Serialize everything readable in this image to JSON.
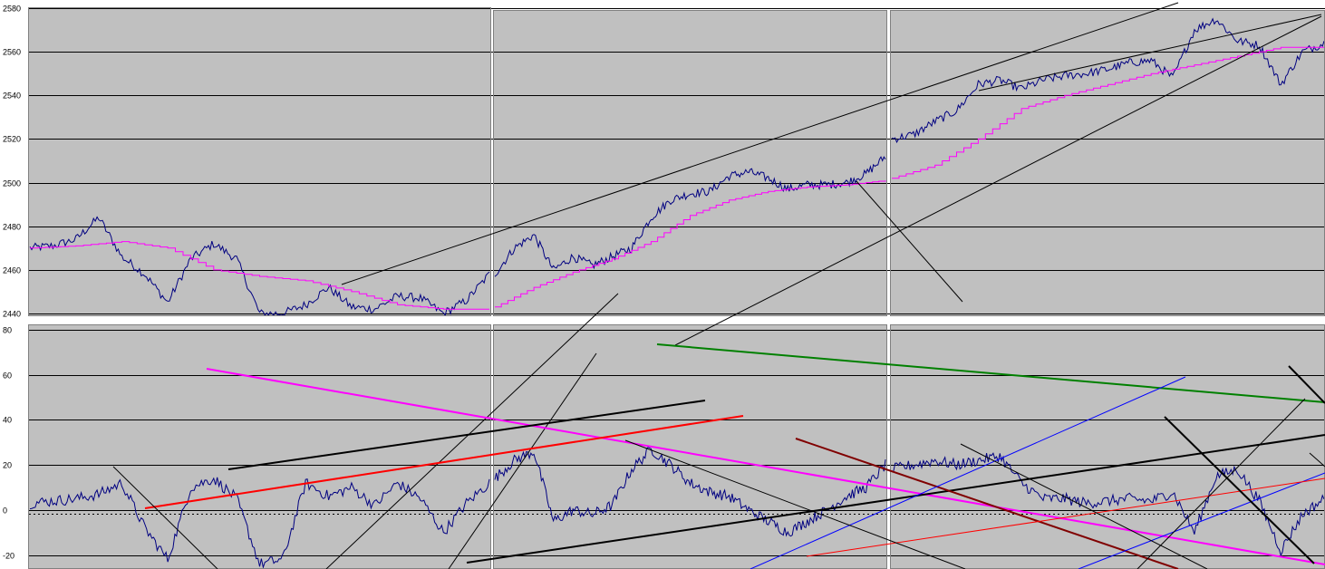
{
  "colors": {
    "plot_bg": "#c0c0c0",
    "grid": "#000000",
    "price": "#000080",
    "average": "#ff00ff",
    "trend_red": "#ff0000",
    "trend_green": "#008000",
    "trend_blue": "#0000ff",
    "trend_darkred": "#800000",
    "trend_black": "#000000"
  },
  "chart_data": [
    {
      "type": "line",
      "title": "",
      "xlabel": "",
      "ylabel": "",
      "ylim": [
        2440,
        2580
      ],
      "yticks": [
        "2580",
        "2560",
        "2540",
        "2520",
        "2500",
        "2480",
        "2460",
        "2440"
      ],
      "grid": true,
      "panels": 3,
      "series": [
        {
          "role": "price",
          "x": [
            0,
            0.05,
            0.1,
            0.15,
            0.2,
            0.25,
            0.3,
            0.35,
            0.4,
            0.45,
            0.5,
            0.55,
            0.6,
            0.65,
            0.7,
            0.75,
            0.8,
            0.85,
            0.9,
            0.95,
            1.0
          ],
          "values": [
            2470,
            2471,
            2474,
            2484,
            2466,
            2458,
            2445,
            2465,
            2472,
            2465,
            2440,
            2440,
            2444,
            2452,
            2443,
            2442,
            2448,
            2447,
            2440,
            2446,
            2458
          ]
        },
        {
          "role": "average",
          "x": [
            0,
            0.1,
            0.2,
            0.3,
            0.4,
            0.5,
            0.6,
            0.7,
            0.8,
            0.9,
            1.0
          ],
          "values": [
            2470,
            2471,
            2473,
            2470,
            2460,
            2457,
            2455,
            2450,
            2444,
            2442,
            2442
          ]
        },
        {
          "role": "price",
          "x": [
            0,
            0.05,
            0.1,
            0.15,
            0.2,
            0.25,
            0.3,
            0.35,
            0.4,
            0.45,
            0.5,
            0.55,
            0.6,
            0.65,
            0.7,
            0.75,
            0.8,
            0.85,
            0.9,
            0.95,
            1.0
          ],
          "values": [
            2458,
            2470,
            2476,
            2460,
            2466,
            2462,
            2466,
            2470,
            2484,
            2492,
            2495,
            2496,
            2503,
            2505,
            2502,
            2497,
            2499,
            2499,
            2500,
            2504,
            2512
          ]
        },
        {
          "role": "average",
          "x": [
            0,
            0.1,
            0.2,
            0.3,
            0.4,
            0.5,
            0.6,
            0.7,
            0.8,
            0.9,
            1.0
          ],
          "values": [
            2443,
            2452,
            2459,
            2465,
            2473,
            2485,
            2492,
            2496,
            2498,
            2499,
            2501
          ]
        },
        {
          "role": "price",
          "x": [
            0,
            0.05,
            0.1,
            0.15,
            0.2,
            0.25,
            0.3,
            0.35,
            0.4,
            0.45,
            0.5,
            0.55,
            0.6,
            0.65,
            0.7,
            0.75,
            0.8,
            0.85,
            0.9,
            0.95,
            1.0
          ],
          "values": [
            2520,
            2522,
            2528,
            2533,
            2545,
            2547,
            2543,
            2547,
            2549,
            2550,
            2552,
            2555,
            2556,
            2548,
            2570,
            2575,
            2565,
            2563,
            2545,
            2560,
            2564
          ]
        },
        {
          "role": "average",
          "x": [
            0,
            0.1,
            0.2,
            0.3,
            0.4,
            0.5,
            0.6,
            0.7,
            0.8,
            0.9,
            1.0
          ],
          "values": [
            2502,
            2508,
            2520,
            2534,
            2540,
            2545,
            2550,
            2554,
            2558,
            2562,
            2562
          ]
        }
      ]
    },
    {
      "type": "line",
      "title": "",
      "xlabel": "",
      "ylabel": "",
      "ylim": [
        -25,
        80
      ],
      "yticks": [
        "80",
        "60",
        "40",
        "20",
        "0",
        "-20"
      ],
      "grid": true,
      "panels": 3,
      "series": [
        {
          "role": "oscillator",
          "x": [
            0,
            0.05,
            0.1,
            0.15,
            0.2,
            0.25,
            0.3,
            0.35,
            0.4,
            0.45,
            0.5,
            0.55,
            0.6,
            0.65,
            0.7,
            0.75,
            0.8,
            0.85,
            0.9,
            0.95,
            1.0
          ],
          "values": [
            3,
            4,
            5,
            7,
            12,
            -8,
            -22,
            10,
            14,
            5,
            -24,
            -22,
            12,
            6,
            10,
            2,
            12,
            5,
            -10,
            3,
            12
          ]
        },
        {
          "role": "oscillator",
          "x": [
            0,
            0.05,
            0.1,
            0.15,
            0.2,
            0.25,
            0.3,
            0.35,
            0.4,
            0.45,
            0.5,
            0.55,
            0.6,
            0.65,
            0.7,
            0.75,
            0.8,
            0.85,
            0.9,
            0.95,
            1.0
          ],
          "values": [
            14,
            22,
            26,
            -5,
            0,
            -2,
            2,
            18,
            27,
            20,
            12,
            8,
            6,
            0,
            -5,
            -10,
            -5,
            0,
            6,
            10,
            20
          ]
        },
        {
          "role": "oscillator",
          "x": [
            0,
            0.05,
            0.1,
            0.15,
            0.2,
            0.25,
            0.3,
            0.35,
            0.4,
            0.45,
            0.5,
            0.55,
            0.6,
            0.65,
            0.7,
            0.75,
            0.8,
            0.85,
            0.9,
            0.95,
            1.0
          ],
          "values": [
            18,
            20,
            22,
            20,
            22,
            24,
            12,
            5,
            5,
            3,
            4,
            5,
            4,
            8,
            -10,
            15,
            18,
            4,
            -18,
            -2,
            5
          ]
        }
      ]
    }
  ]
}
